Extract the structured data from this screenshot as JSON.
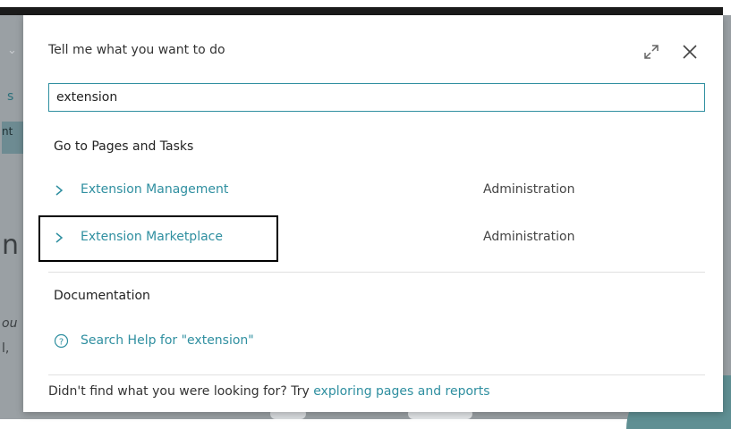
{
  "dialog": {
    "title": "Tell me what you want to do",
    "search_value": "extension",
    "sections": {
      "pages_title": "Go to Pages and Tasks",
      "docs_title": "Documentation"
    },
    "results": [
      {
        "label": "Extension Management",
        "category": "Administration"
      },
      {
        "label": "Extension Marketplace",
        "category": "Administration"
      }
    ],
    "help_link": "Search Help for \"extension\"",
    "footer_text": "Didn't find what you were looking for? Try ",
    "footer_link": "exploring pages and reports"
  },
  "background": {
    "snippet_s": "s",
    "snippet_nt": "nt",
    "snippet_n": "n",
    "snippet_u": "ou",
    "snippet_comma": "l,"
  },
  "colors": {
    "accent": "#2f8fa0",
    "overlay": "#9aa0a4",
    "highlight_border": "#000000"
  },
  "icons": [
    "chevron-right-icon",
    "expand-icon",
    "close-icon",
    "help-circle-icon"
  ]
}
